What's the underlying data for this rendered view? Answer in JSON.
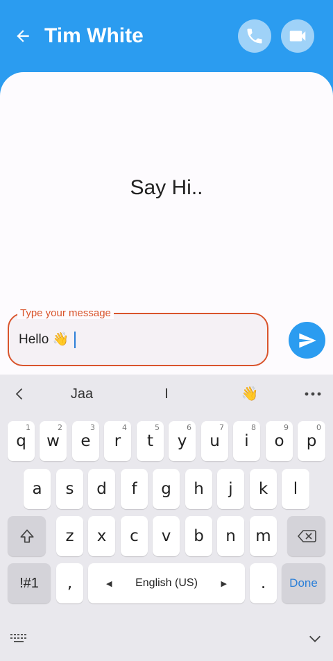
{
  "header": {
    "title": "Tim White",
    "bg_color": "#2b9cf0",
    "back_icon": "arrow-left-icon",
    "call_icon": "phone-icon",
    "video_icon": "video-camera-icon"
  },
  "chat": {
    "empty_text": "Say Hi.."
  },
  "composer": {
    "label": "Type your message",
    "value": "Hello 👋",
    "accent_color": "#d9542c",
    "send_icon": "send-icon"
  },
  "keyboard": {
    "suggestions": [
      "Jaa",
      "I",
      "👋"
    ],
    "row1": [
      {
        "k": "q",
        "h": "1"
      },
      {
        "k": "w",
        "h": "2"
      },
      {
        "k": "e",
        "h": "3"
      },
      {
        "k": "r",
        "h": "4"
      },
      {
        "k": "t",
        "h": "5"
      },
      {
        "k": "y",
        "h": "6"
      },
      {
        "k": "u",
        "h": "7"
      },
      {
        "k": "i",
        "h": "8"
      },
      {
        "k": "o",
        "h": "9"
      },
      {
        "k": "p",
        "h": "0"
      }
    ],
    "row2": [
      "a",
      "s",
      "d",
      "f",
      "g",
      "h",
      "j",
      "k",
      "l"
    ],
    "row3": [
      "z",
      "x",
      "c",
      "v",
      "b",
      "n",
      "m"
    ],
    "symbols_label": "!#1",
    "comma_label": ",",
    "language_label": "English (US)",
    "period_label": ".",
    "done_label": "Done"
  }
}
